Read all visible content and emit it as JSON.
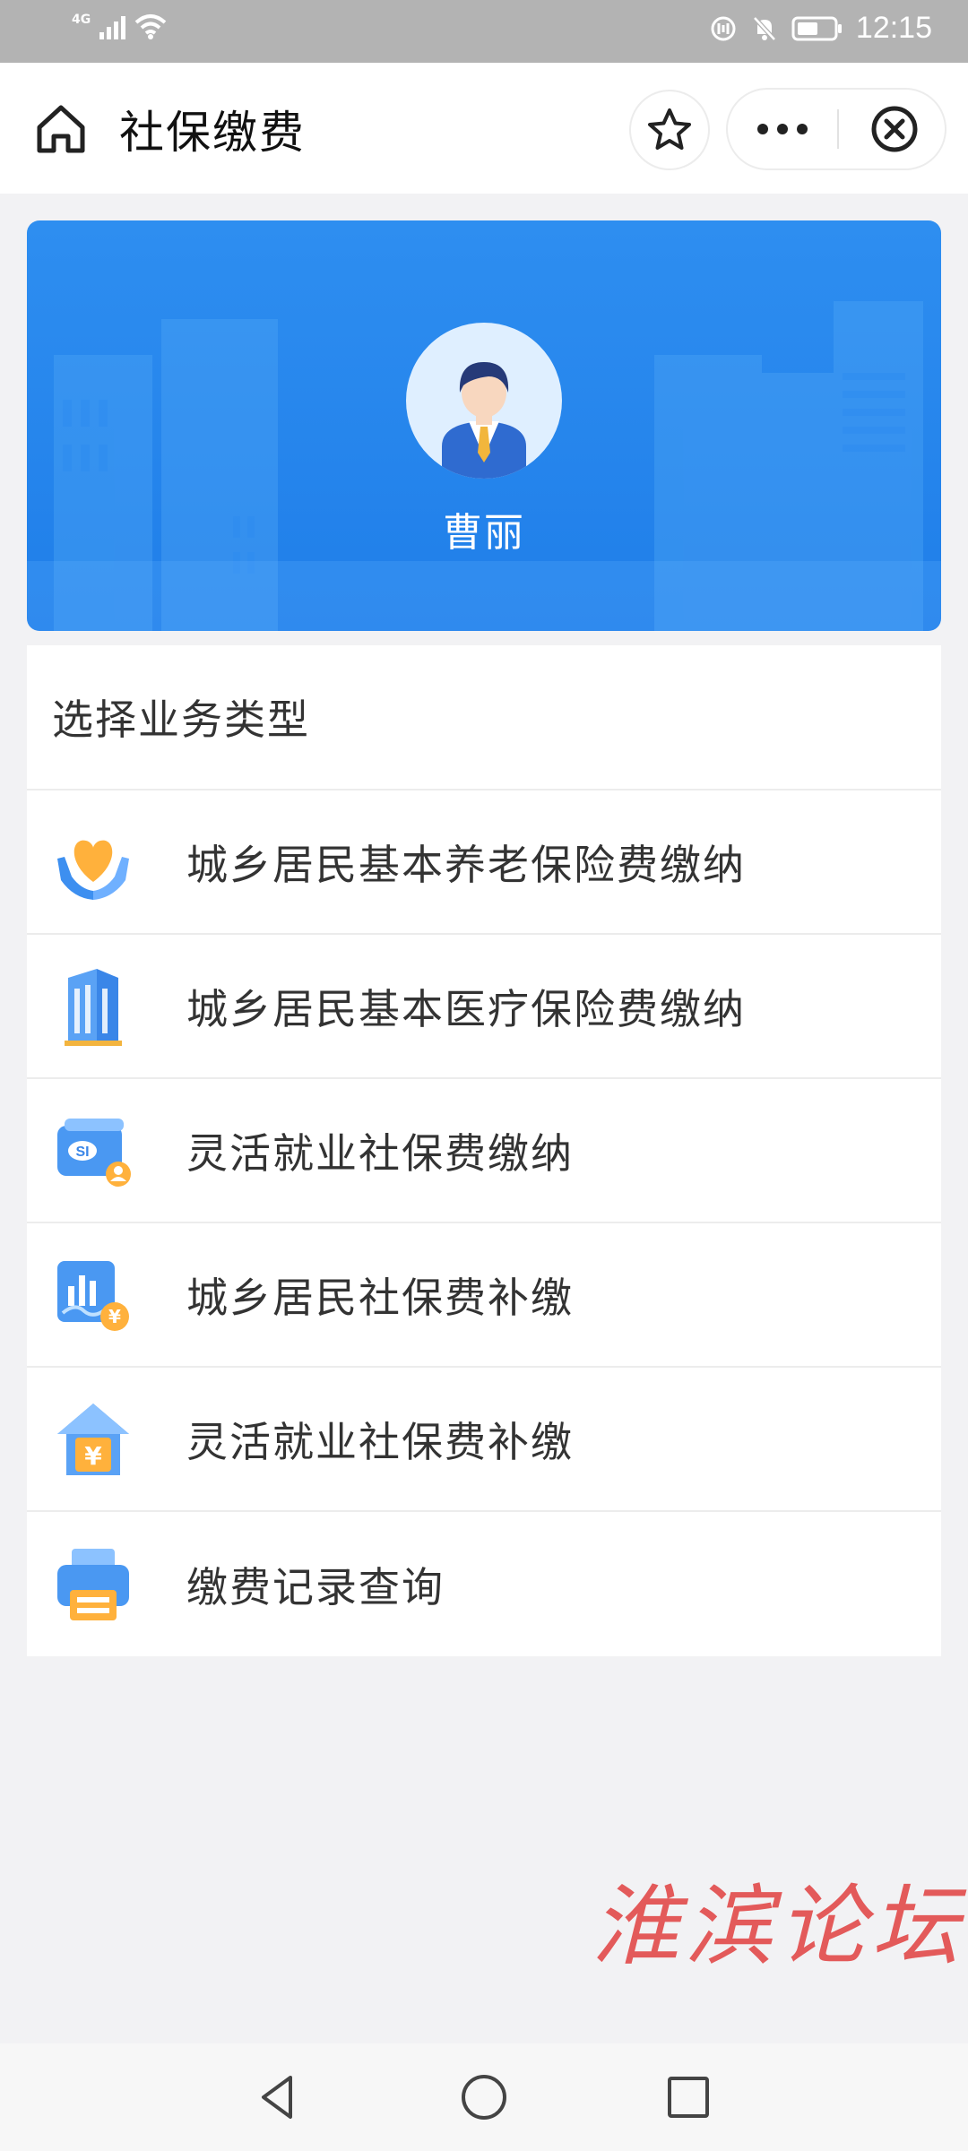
{
  "status_bar": {
    "network": "4G",
    "time": "12:15",
    "icons": [
      "signal-icon",
      "wifi-icon",
      "data-saver-icon",
      "mute-icon",
      "battery-icon"
    ]
  },
  "header": {
    "title": "社保缴费",
    "icons": [
      "home-icon",
      "star-icon",
      "more-icon",
      "close-icon"
    ]
  },
  "profile": {
    "name": "曹丽",
    "banner_color": "#2589ee"
  },
  "service_list": {
    "title": "选择业务类型",
    "items": [
      {
        "label": "城乡居民基本养老保险费缴纳",
        "icon": "care-hands-heart-icon"
      },
      {
        "label": "城乡居民基本医疗保险费缴纳",
        "icon": "hospital-building-icon"
      },
      {
        "label": "灵活就业社保费缴纳",
        "icon": "social-security-card-icon"
      },
      {
        "label": "城乡居民社保费补缴",
        "icon": "chart-yuan-icon"
      },
      {
        "label": "灵活就业社保费补缴",
        "icon": "house-yuan-icon"
      },
      {
        "label": "缴费记录查询",
        "icon": "printer-record-icon"
      }
    ]
  },
  "watermark": {
    "text": "淮滨论坛",
    "color": "#e24a4a"
  },
  "nav_bar": {
    "icons": [
      "back-icon",
      "home-circle-icon",
      "recents-icon"
    ]
  }
}
